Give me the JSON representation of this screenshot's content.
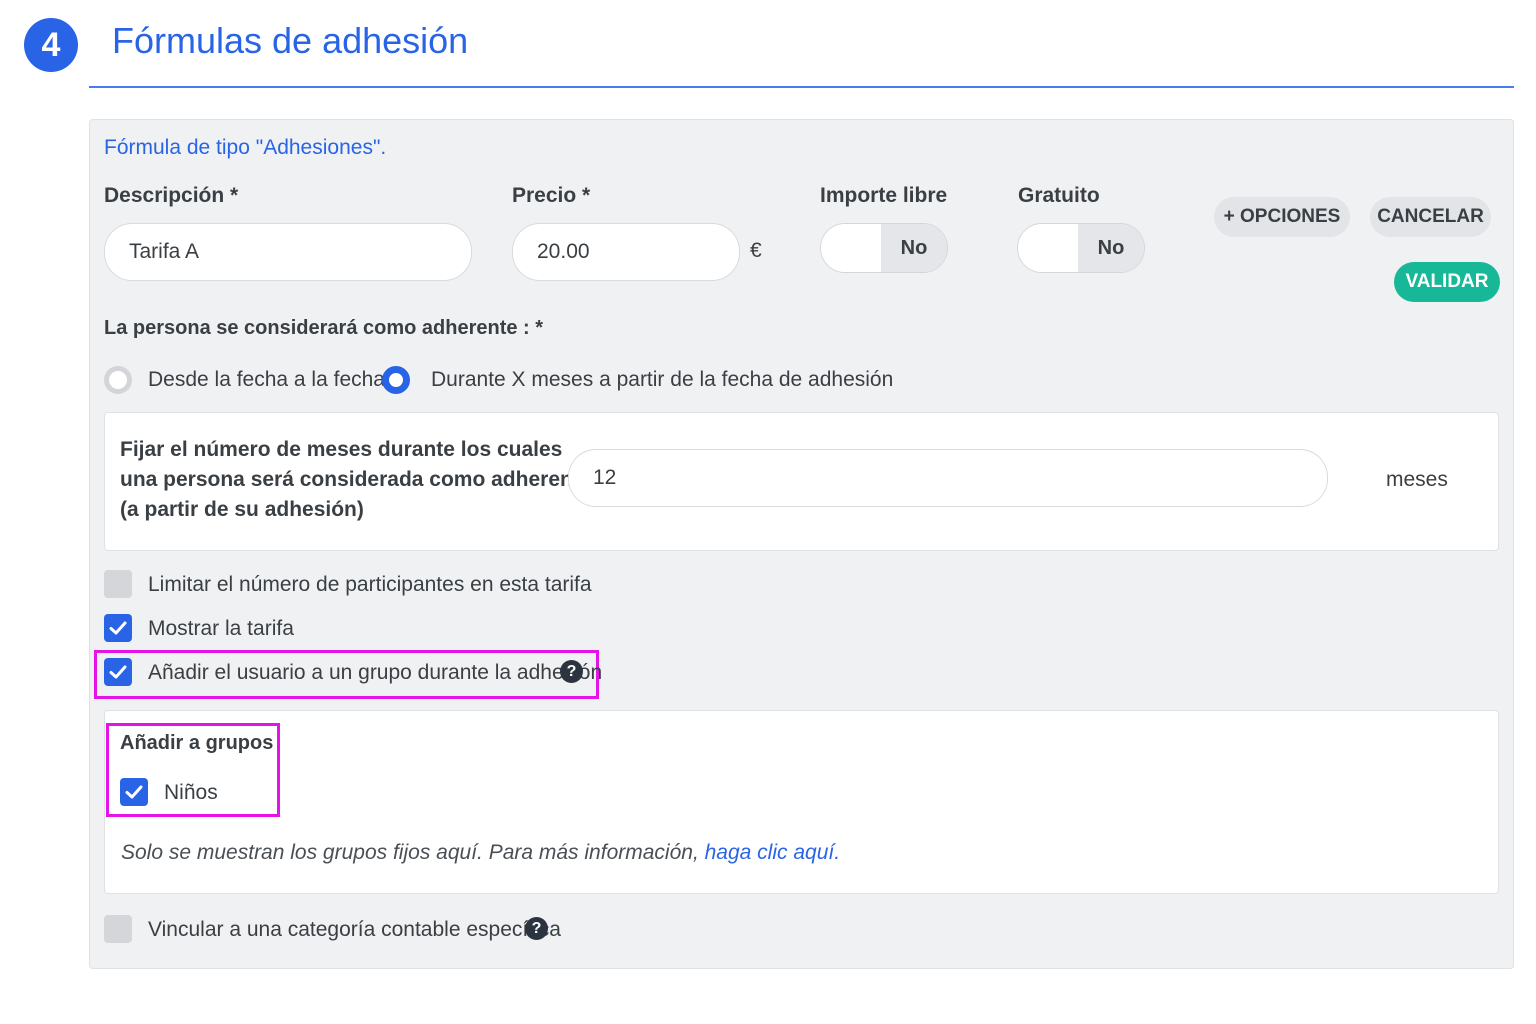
{
  "section": {
    "step_number": "4",
    "title": "Fórmulas de adhesión"
  },
  "form": {
    "subtitle": "Fórmula de tipo \"Adhesiones\".",
    "description": {
      "label": "Descripción *",
      "value": "Tarifa A"
    },
    "price": {
      "label": "Precio *",
      "value": "20.00",
      "currency": "€"
    },
    "free_amount": {
      "label": "Importe libre",
      "state": "No"
    },
    "free_of_charge": {
      "label": "Gratuito",
      "state": "No"
    },
    "buttons": {
      "options": "+ OPCIONES",
      "cancel": "CANCELAR",
      "validate": "VALIDAR"
    },
    "membership": {
      "label": "La persona se considerará como adherente : *",
      "options": [
        {
          "label": "Desde la fecha a la fecha",
          "selected": false
        },
        {
          "label": "Durante X meses a partir de la fecha de adhesión",
          "selected": true
        }
      ]
    },
    "months": {
      "label_line1": "Fijar el número de meses durante los cuales",
      "label_line2": "una persona será considerada como adherente",
      "label_line3": "(a partir de su adhesión)",
      "value": "12",
      "unit": "meses"
    },
    "checkboxes": {
      "limit_participants": {
        "label": "Limitar el número de participantes en esta tarifa",
        "checked": false
      },
      "show_rate": {
        "label": "Mostrar la tarifa",
        "checked": true
      },
      "add_to_group": {
        "label": "Añadir el usuario a un grupo durante la adhesión",
        "checked": true
      },
      "accounting_category": {
        "label": "Vincular a una categoría contable específica",
        "checked": false
      }
    },
    "groups": {
      "title": "Añadir a grupos",
      "items": [
        {
          "label": "Niños",
          "checked": true
        }
      ],
      "note_text": "Solo se muestran los grupos fijos aquí. Para más información, ",
      "note_link": "haga clic aquí."
    },
    "help_icon_glyph": "?"
  },
  "colors": {
    "primary_blue": "#2a64e6",
    "validate_green": "#17b897",
    "highlight_magenta": "#e513e8",
    "panel_background": "#f0f1f3"
  },
  "icons": [
    "check-icon",
    "help-icon"
  ]
}
